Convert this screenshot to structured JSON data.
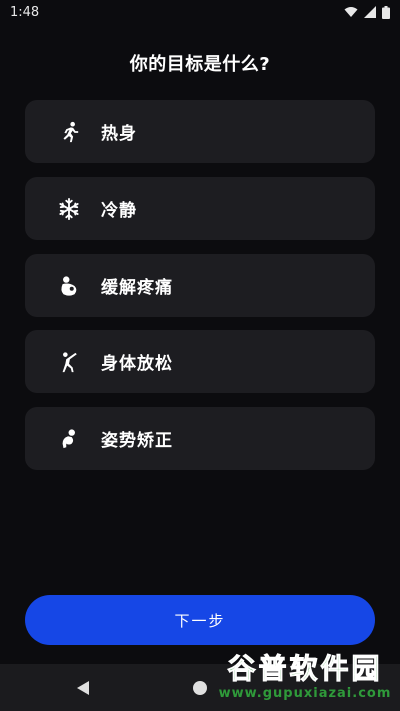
{
  "status_bar": {
    "time": "1:48"
  },
  "page": {
    "title": "你的目标是什么?"
  },
  "options": [
    {
      "label": "热身",
      "icon": "running-person-icon"
    },
    {
      "label": "冷静",
      "icon": "snowflake-icon"
    },
    {
      "label": "缓解疼痛",
      "icon": "pain-relief-person-icon"
    },
    {
      "label": "身体放松",
      "icon": "stretching-person-icon"
    },
    {
      "label": "姿势矫正",
      "icon": "posture-person-icon"
    }
  ],
  "next_button": {
    "label": "下一步"
  },
  "watermark": {
    "brand": "谷普软件园",
    "url": "www.gupuxiazai.com"
  },
  "colors": {
    "background": "#0c0c0f",
    "card": "#1d1d21",
    "accent": "#1647e6",
    "watermark": "#2f9a3a"
  }
}
